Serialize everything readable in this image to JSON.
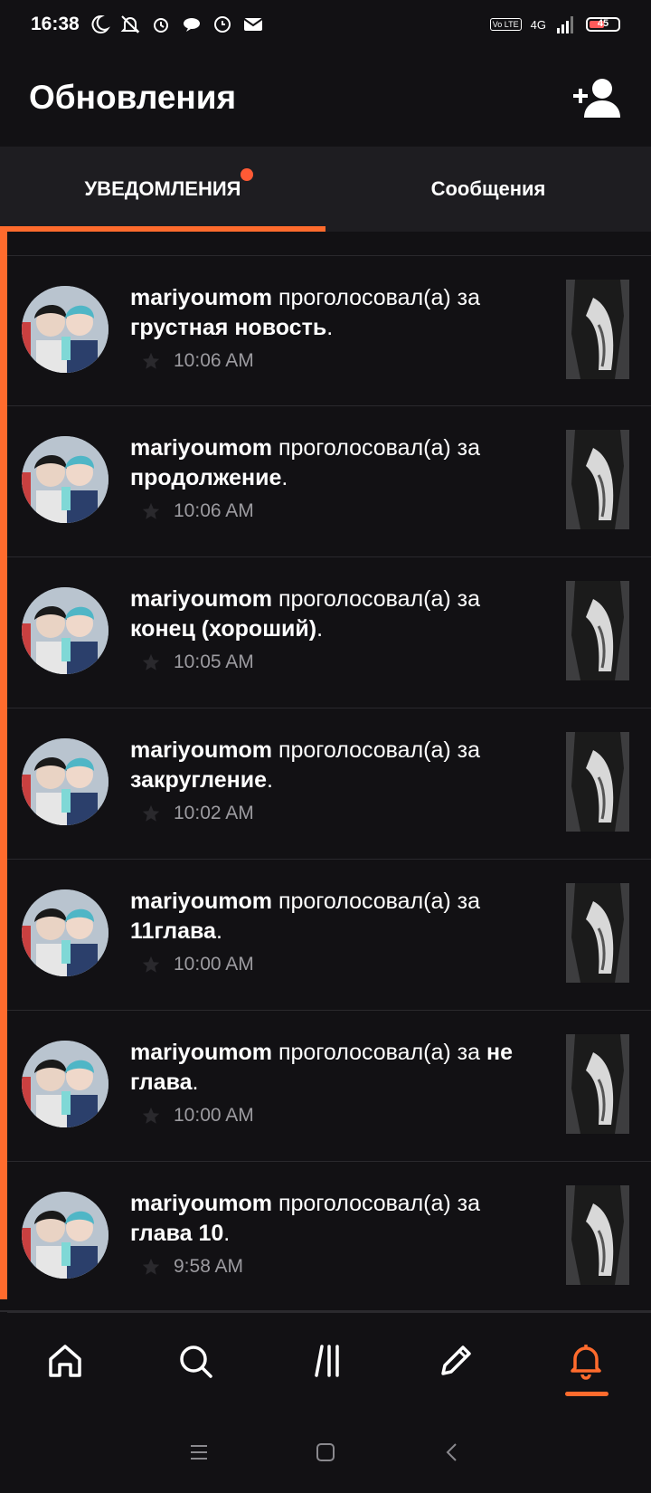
{
  "status_bar": {
    "time": "16:38",
    "network": "4G",
    "volte": "Vo LTE",
    "battery": "45"
  },
  "header": {
    "title": "Обновления",
    "add_user_icon": "add-person-icon"
  },
  "tabs": [
    {
      "label": "УВЕДОМЛЕНИЯ",
      "active": true,
      "has_badge": true
    },
    {
      "label": "Сообщения",
      "active": false,
      "has_badge": false
    }
  ],
  "colors": {
    "accent": "#ff6b2d",
    "background": "#121114",
    "secondary_text": "#9c9ba0"
  },
  "notifications": [
    {
      "user": "mariyoumom",
      "action": "проголосовал(а) за",
      "target": "грустная новость",
      "period": ".",
      "time": "10:06 AM"
    },
    {
      "user": "mariyoumom",
      "action": "проголосовал(а) за",
      "target": "продолжение",
      "period": ".",
      "time": "10:06 AM"
    },
    {
      "user": "mariyoumom",
      "action": "проголосовал(а) за",
      "target": "конец (хороший)",
      "period": ".",
      "time": "10:05 AM"
    },
    {
      "user": "mariyoumom",
      "action": "проголосовал(а) за",
      "target": "закругление",
      "period": ".",
      "time": "10:02 AM"
    },
    {
      "user": "mariyoumom",
      "action": "проголосовал(а) за",
      "target": "11глава",
      "period": ".",
      "time": "10:00 AM"
    },
    {
      "user": "mariyoumom",
      "action": "проголосовал(а) за",
      "target": "не глава",
      "period": ".",
      "time": "10:00 AM"
    },
    {
      "user": "mariyoumom",
      "action": "проголосовал(а) за",
      "target": "глава 10",
      "period": ".",
      "time": "9:58 AM"
    }
  ],
  "bottom_nav": [
    {
      "icon": "home-icon",
      "active": false
    },
    {
      "icon": "search-icon",
      "active": false
    },
    {
      "icon": "library-icon",
      "active": false
    },
    {
      "icon": "write-icon",
      "active": false
    },
    {
      "icon": "notifications-bell-icon",
      "active": true
    }
  ],
  "system_nav": [
    "menu-icon",
    "home-square-icon",
    "back-icon"
  ]
}
